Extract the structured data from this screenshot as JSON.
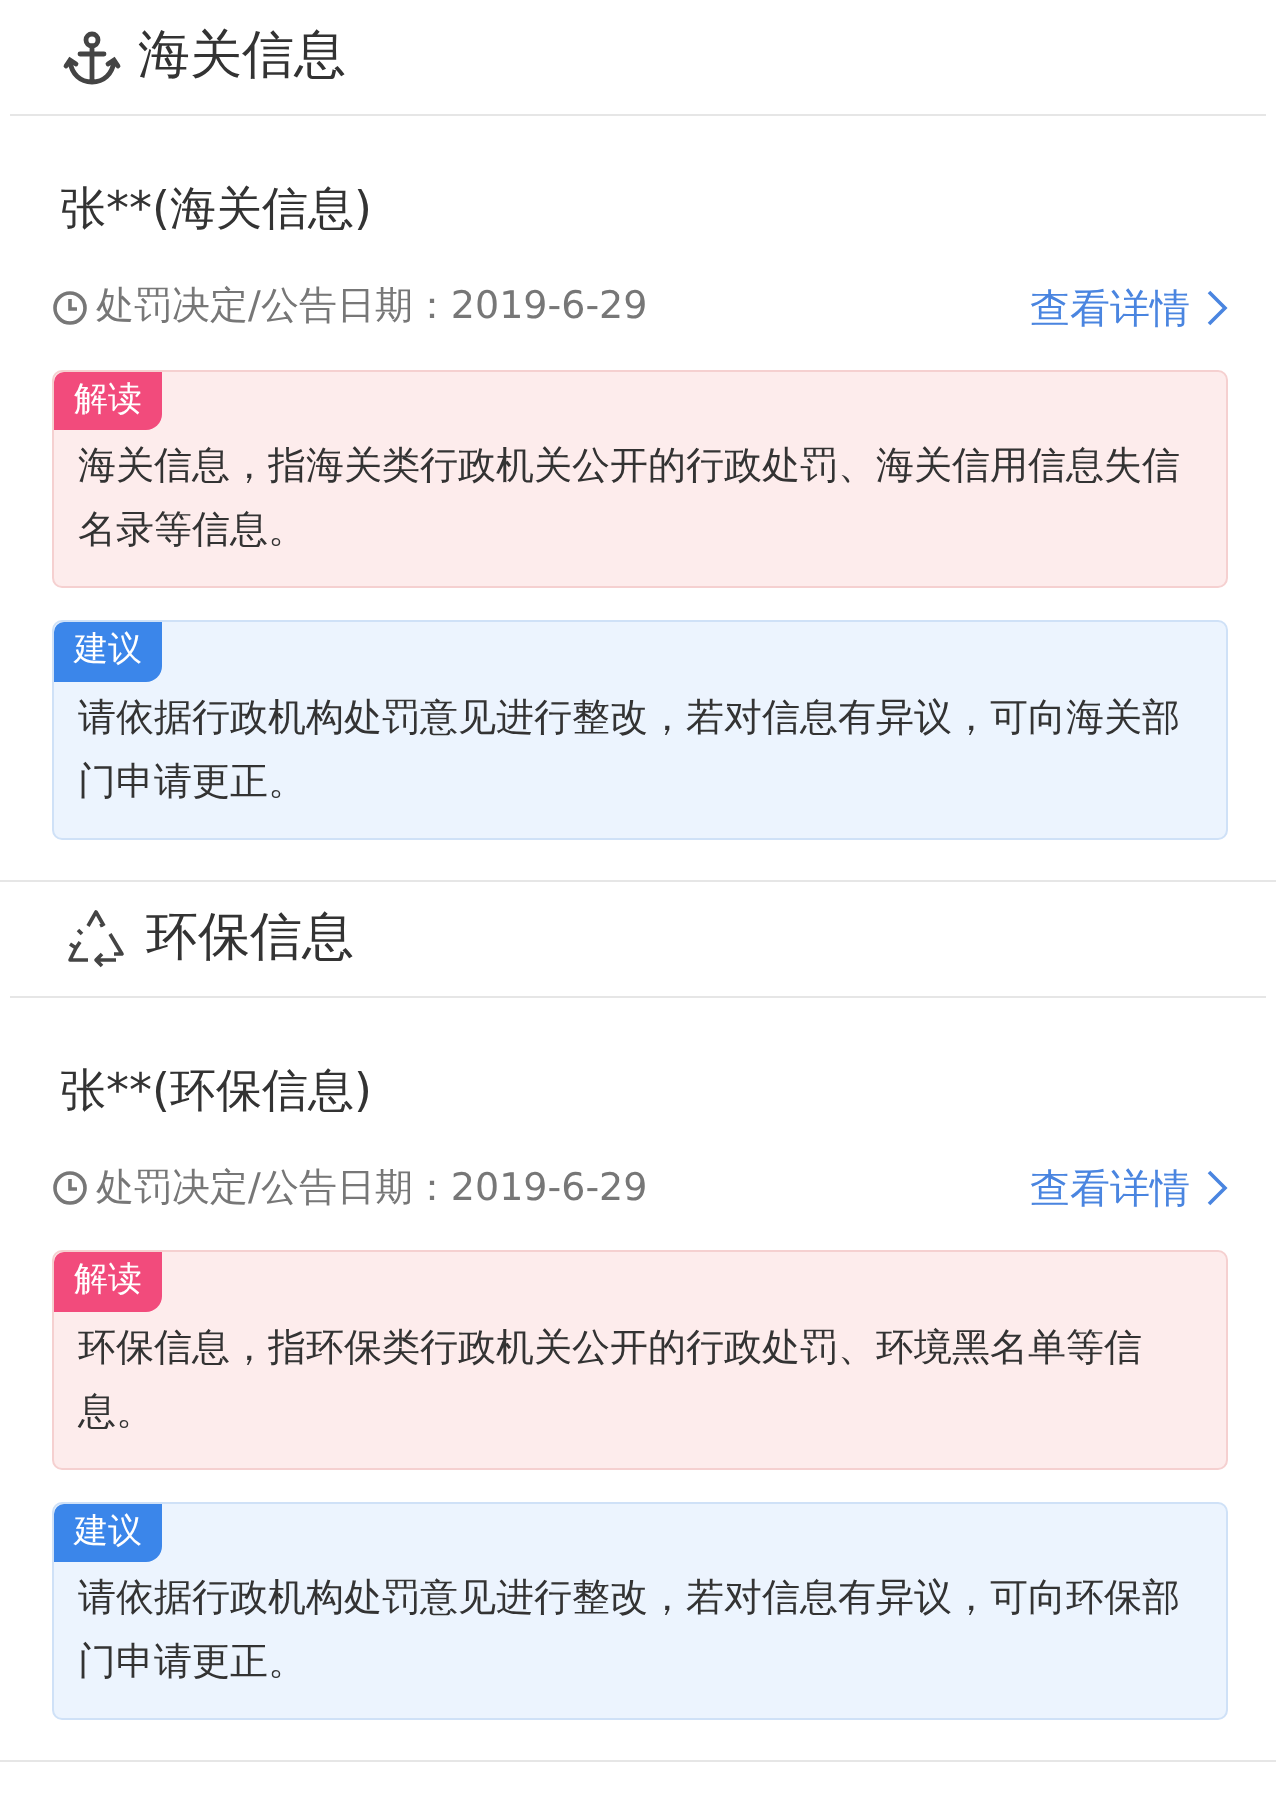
{
  "sections": [
    {
      "kind": "anchor",
      "title": "海关信息",
      "record": {
        "name": "张**(海关信息)",
        "date_label": "处罚决定/公告日期：2019-6-29",
        "link": "查看详情"
      },
      "notes": [
        {
          "kind": "interpret",
          "tag": "解读",
          "text": "海关信息，指海关类行政机关公开的行政处罚、海关信用信息失信名录等信息。"
        },
        {
          "kind": "advice",
          "tag": "建议",
          "text": "请依据行政机构处罚意见进行整改，若对信息有异议，可向海关部门申请更正。"
        }
      ]
    },
    {
      "kind": "recycle",
      "title": "环保信息",
      "record": {
        "name": "张**(环保信息)",
        "date_label": "处罚决定/公告日期：2019-6-29",
        "link": "查看详情"
      },
      "notes": [
        {
          "kind": "interpret",
          "tag": "解读",
          "text": "环保信息，指环保类行政机关公开的行政处罚、环境黑名单等信息。"
        },
        {
          "kind": "advice",
          "tag": "建议",
          "text": "请依据行政机构处罚意见进行整改，若对信息有异议，可向环保部门申请更正。"
        }
      ]
    }
  ]
}
